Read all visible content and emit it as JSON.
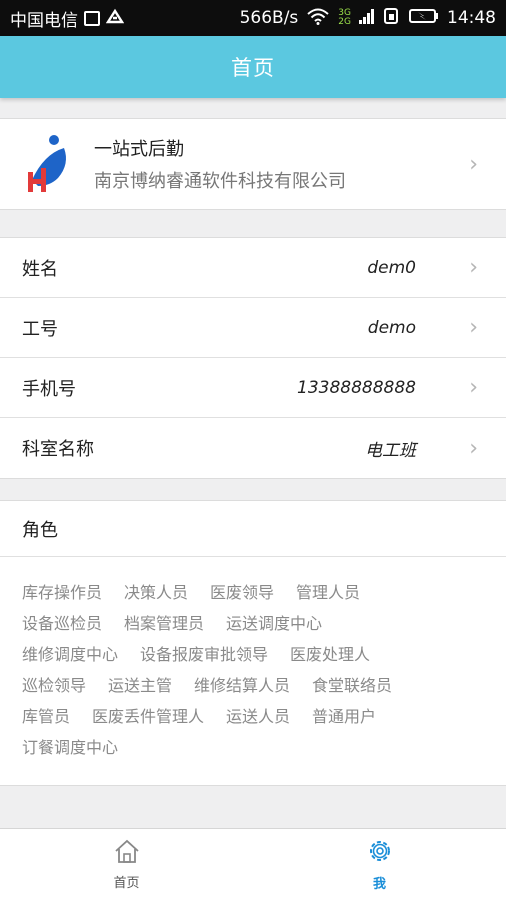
{
  "status_bar": {
    "carrier": "中国电信",
    "speed": "566B/s",
    "net_top": "3G",
    "net_bottom": "2G",
    "time": "14:48"
  },
  "header": {
    "title": "首页"
  },
  "company": {
    "app_name": "一站式后勤",
    "company_name": "南京博纳睿通软件科技有限公司",
    "logo_colors": [
      "#1e64c8",
      "#e23a3a"
    ]
  },
  "profile": {
    "rows": [
      {
        "label": "姓名",
        "value": "dem0"
      },
      {
        "label": "工号",
        "value": "demo"
      },
      {
        "label": "手机号",
        "value": "13388888888"
      },
      {
        "label": "科室名称",
        "value": "电工班"
      }
    ]
  },
  "roles": {
    "title": "角色",
    "lines": [
      [
        "库存操作员",
        "决策人员",
        "医废领导",
        "管理人员"
      ],
      [
        "设备巡检员",
        "档案管理员",
        "运送调度中心"
      ],
      [
        "维修调度中心",
        "设备报废审批领导",
        "医废处理人"
      ],
      [
        "巡检领导",
        "运送主管",
        "维修结算人员",
        "食堂联络员"
      ],
      [
        "库管员",
        "医废丢件管理人",
        "运送人员",
        "普通用户"
      ],
      [
        "订餐调度中心"
      ]
    ]
  },
  "tabbar": {
    "tabs": [
      {
        "label": "首页",
        "icon": "home-icon"
      },
      {
        "label": "我",
        "icon": "gear-icon"
      }
    ],
    "active_color": "#1a8ed8"
  },
  "colors": {
    "appbar": "#5bc8e0"
  }
}
